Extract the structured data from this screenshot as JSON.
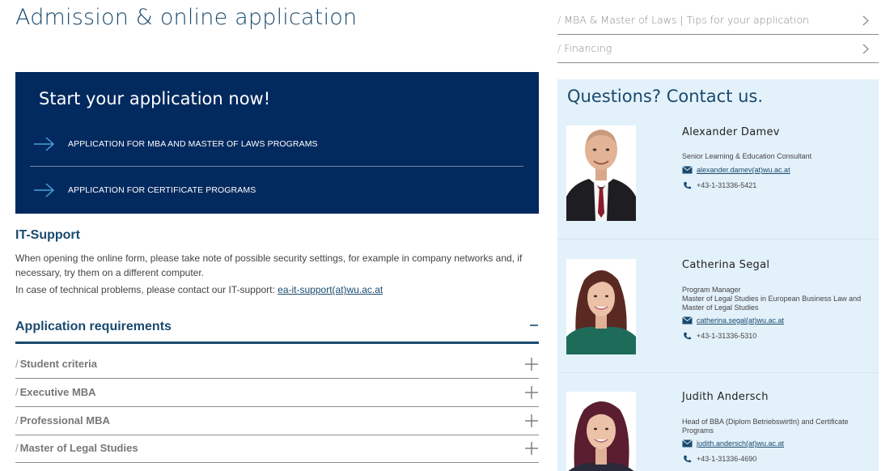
{
  "page": {
    "title": "Admission & online application"
  },
  "cta": {
    "title": "Start your application now!",
    "links": [
      {
        "label": "APPLICATION FOR MBA AND MASTER OF LAWS PROGRAMS",
        "icon": "arrow-right-icon"
      },
      {
        "label": "APPLICATION FOR CERTIFICATE PROGRAMS",
        "icon": "arrow-right-icon"
      }
    ]
  },
  "it_support": {
    "title": "IT-Support",
    "paragraph1": "When opening the online form, please take note of possible security settings, for example in company networks and, if necessary, try them on a different computer.",
    "paragraph2_prefix": "In case of technical problems, please contact our IT-support: ",
    "email": "ea-it-support(at)wu.ac.at"
  },
  "requirements": {
    "title": "Application requirements",
    "toggle_icon": "minus-icon",
    "items": [
      {
        "label": "Student criteria"
      },
      {
        "label": "Executive MBA"
      },
      {
        "label": "Professional MBA"
      },
      {
        "label": "Master of Legal Studies"
      }
    ],
    "slash": "/"
  },
  "side_links": [
    {
      "label": "MBA & Master of Laws | Tips for your application",
      "icon": "chevron-right-icon"
    },
    {
      "label": "Financing",
      "icon": "chevron-right-icon"
    }
  ],
  "contact": {
    "title": "Questions? Contact us.",
    "people": [
      {
        "name": "Alexander Damev",
        "role": "Senior Learning & Education Consultant",
        "email": "alexander.damev(at)wu.ac.at",
        "phone": "+43-1-31336-5421"
      },
      {
        "name": "Catherina Segal",
        "role": "Program Manager\nMaster of Legal Studies in European Business Law and Master of Legal Studies",
        "email": "catherina.segal(at)wu.ac.at",
        "phone": "+43-1-31336-5310"
      },
      {
        "name": "Judith Andersch",
        "role": "Head of BBA (Diplom BetriebswirtIn) and Certificate Programs",
        "email": "judith.andersch(at)wu.ac.at",
        "phone": "+43-1-31336-4690"
      }
    ]
  },
  "colors": {
    "brand_navy": "#032a5f",
    "heading_blue": "#1a4a6e",
    "contact_panel_bg": "#e3f1fa",
    "cta_arrow": "#4a9fd8"
  }
}
